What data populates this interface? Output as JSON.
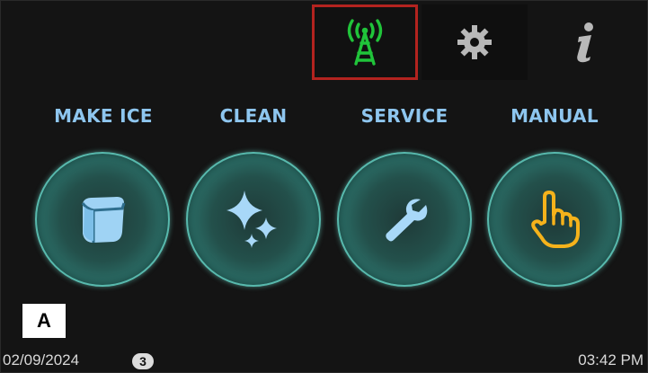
{
  "toolbar": {
    "connectivity": {
      "icon": "cell-tower-icon",
      "color": "#20c43a",
      "selected": true
    },
    "settings": {
      "icon": "gear-icon",
      "color": "#b8b8b8"
    },
    "info": {
      "icon": "info-icon",
      "color": "#b8b8b8"
    }
  },
  "modes": [
    {
      "label": "MAKE ICE",
      "icon": "ice-cube-icon"
    },
    {
      "label": "CLEAN",
      "icon": "sparkle-icon"
    },
    {
      "label": "SERVICE",
      "icon": "wrench-icon"
    },
    {
      "label": "MANUAL",
      "icon": "hand-pointer-icon"
    }
  ],
  "marker": {
    "label": "A"
  },
  "status": {
    "date": "02/09/2024",
    "count": "3",
    "time": "03:42 PM"
  },
  "colors": {
    "accent": "#8ec6ef",
    "highlight_border": "#b3231f",
    "manual_icon": "#f5b21b"
  }
}
